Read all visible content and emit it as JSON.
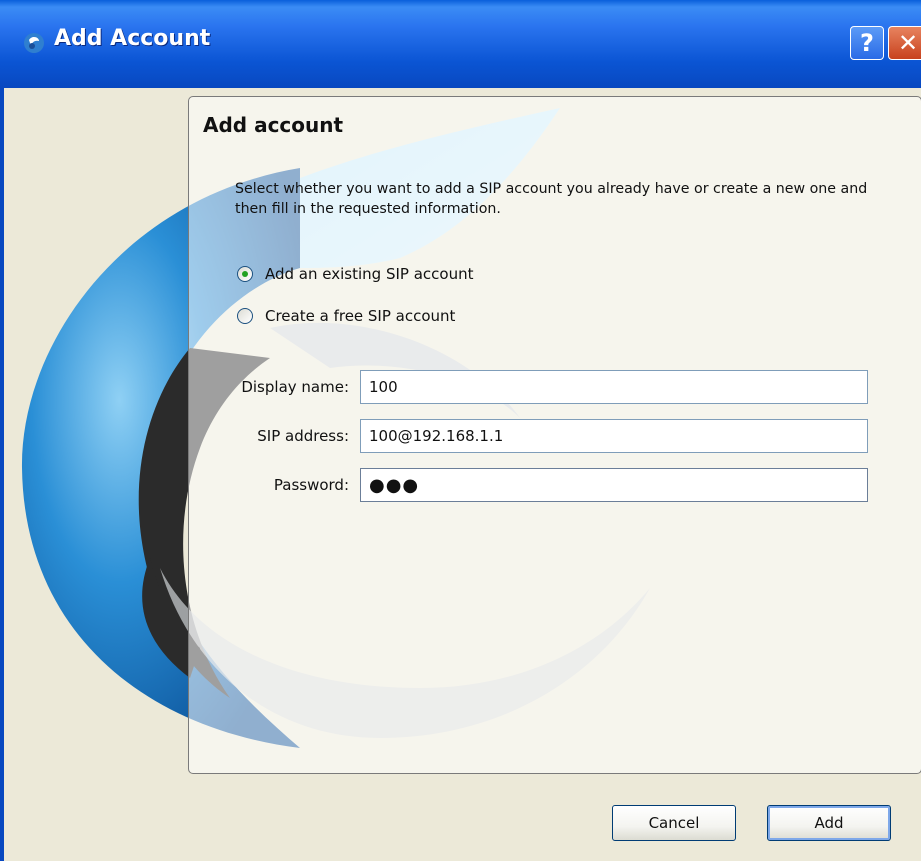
{
  "window": {
    "title": "Add Account",
    "help_label": "?",
    "close_label": "✕"
  },
  "panel": {
    "title": "Add account",
    "description": "Select whether you want to add a SIP account you already have or create a new one and then fill in the requested information."
  },
  "options": {
    "existing_label": "Add an existing SIP account",
    "existing_selected": true,
    "create_label": "Create a free SIP account",
    "create_selected": false
  },
  "form": {
    "display_name_label": "Display name:",
    "display_name_value": "100",
    "sip_address_label": "SIP address:",
    "sip_address_value": "100@192.168.1.1",
    "password_label": "Password:",
    "password_value": "●●●"
  },
  "buttons": {
    "cancel_label": "Cancel",
    "add_label": "Add"
  },
  "colors": {
    "titlebar": "#0b55d4",
    "window_bg": "#ece9d8",
    "logo_blue": "#1a6fb4",
    "radio_dot": "#21a121"
  },
  "icons": {
    "title": "app-logo-icon",
    "help": "help-icon",
    "close": "close-icon"
  }
}
